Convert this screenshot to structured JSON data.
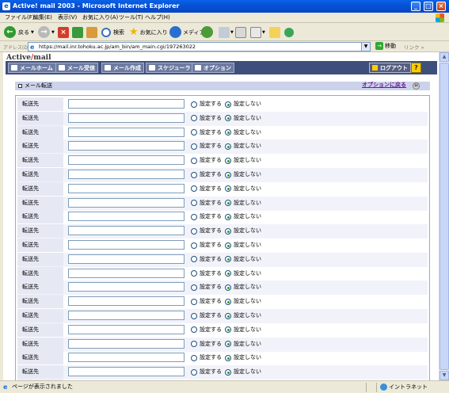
{
  "window": {
    "title": "Active! mail 2003 - Microsoft Internet Explorer",
    "controls": {
      "minimize": "_",
      "maximize": "□",
      "close": "×"
    }
  },
  "menu": [
    "ファイル(F)",
    "編集(E)",
    "表示(V)",
    "お気に入り(A)",
    "ツール(T)",
    "ヘルプ(H)"
  ],
  "toolbar": {
    "back": "戻る",
    "search": "検索",
    "favorites": "お気に入り",
    "media": "メディア"
  },
  "address": {
    "label": "アドレス(D)",
    "url": "https://mail.inr.tohoku.ac.jp/am_bin/am_main.cgi/197263022",
    "go": "移動",
    "links": "リンク »"
  },
  "app": {
    "brand_prefix": "Active",
    "brand_slash": "/",
    "brand_suffix": "mail",
    "nav": [
      "メールホーム",
      "メール受信",
      "メール作成",
      "スケジューラ",
      "オプション"
    ],
    "logout": "ログアウト",
    "help": "?"
  },
  "section": {
    "title": "メール転送",
    "back_link": "オプションに戻る",
    "help_icon": "H"
  },
  "forward_rows": [
    {
      "label": "転送先",
      "value": "",
      "opt_on": "設定する",
      "opt_off": "設定しない",
      "selected": "off"
    },
    {
      "label": "転送先",
      "value": "",
      "opt_on": "設定する",
      "opt_off": "設定しない",
      "selected": "off"
    },
    {
      "label": "転送先",
      "value": "",
      "opt_on": "設定する",
      "opt_off": "設定しない",
      "selected": "off"
    },
    {
      "label": "転送先",
      "value": "",
      "opt_on": "設定する",
      "opt_off": "設定しない",
      "selected": "off"
    },
    {
      "label": "転送先",
      "value": "",
      "opt_on": "設定する",
      "opt_off": "設定しない",
      "selected": "off"
    },
    {
      "label": "転送先",
      "value": "",
      "opt_on": "設定する",
      "opt_off": "設定しない",
      "selected": "off"
    },
    {
      "label": "転送先",
      "value": "",
      "opt_on": "設定する",
      "opt_off": "設定しない",
      "selected": "off"
    },
    {
      "label": "転送先",
      "value": "",
      "opt_on": "設定する",
      "opt_off": "設定しない",
      "selected": "off"
    },
    {
      "label": "転送先",
      "value": "",
      "opt_on": "設定する",
      "opt_off": "設定しない",
      "selected": "off"
    },
    {
      "label": "転送先",
      "value": "",
      "opt_on": "設定する",
      "opt_off": "設定しない",
      "selected": "off"
    },
    {
      "label": "転送先",
      "value": "",
      "opt_on": "設定する",
      "opt_off": "設定しない",
      "selected": "off"
    },
    {
      "label": "転送先",
      "value": "",
      "opt_on": "設定する",
      "opt_off": "設定しない",
      "selected": "off"
    },
    {
      "label": "転送先",
      "value": "",
      "opt_on": "設定する",
      "opt_off": "設定しない",
      "selected": "off"
    },
    {
      "label": "転送先",
      "value": "",
      "opt_on": "設定する",
      "opt_off": "設定しない",
      "selected": "off"
    },
    {
      "label": "転送先",
      "value": "",
      "opt_on": "設定する",
      "opt_off": "設定しない",
      "selected": "off"
    },
    {
      "label": "転送先",
      "value": "",
      "opt_on": "設定する",
      "opt_off": "設定しない",
      "selected": "off"
    },
    {
      "label": "転送先",
      "value": "",
      "opt_on": "設定する",
      "opt_off": "設定しない",
      "selected": "off"
    },
    {
      "label": "転送先",
      "value": "",
      "opt_on": "設定する",
      "opt_off": "設定しない",
      "selected": "off"
    },
    {
      "label": "転送先",
      "value": "",
      "opt_on": "設定する",
      "opt_off": "設定しない",
      "selected": "off"
    },
    {
      "label": "転送先",
      "value": "",
      "opt_on": "設定する",
      "opt_off": "設定しない",
      "selected": "off"
    },
    {
      "label": "転送先",
      "value": "",
      "opt_on": "設定する",
      "opt_off": "設定しない",
      "selected": "off"
    }
  ],
  "status": {
    "text": "ページが表示されました",
    "zone": "イントラネット"
  },
  "colors": {
    "nav_bg": "#3f4f7b",
    "section_bar": "#ccd2ea",
    "back_link": "#6a1b9a"
  }
}
